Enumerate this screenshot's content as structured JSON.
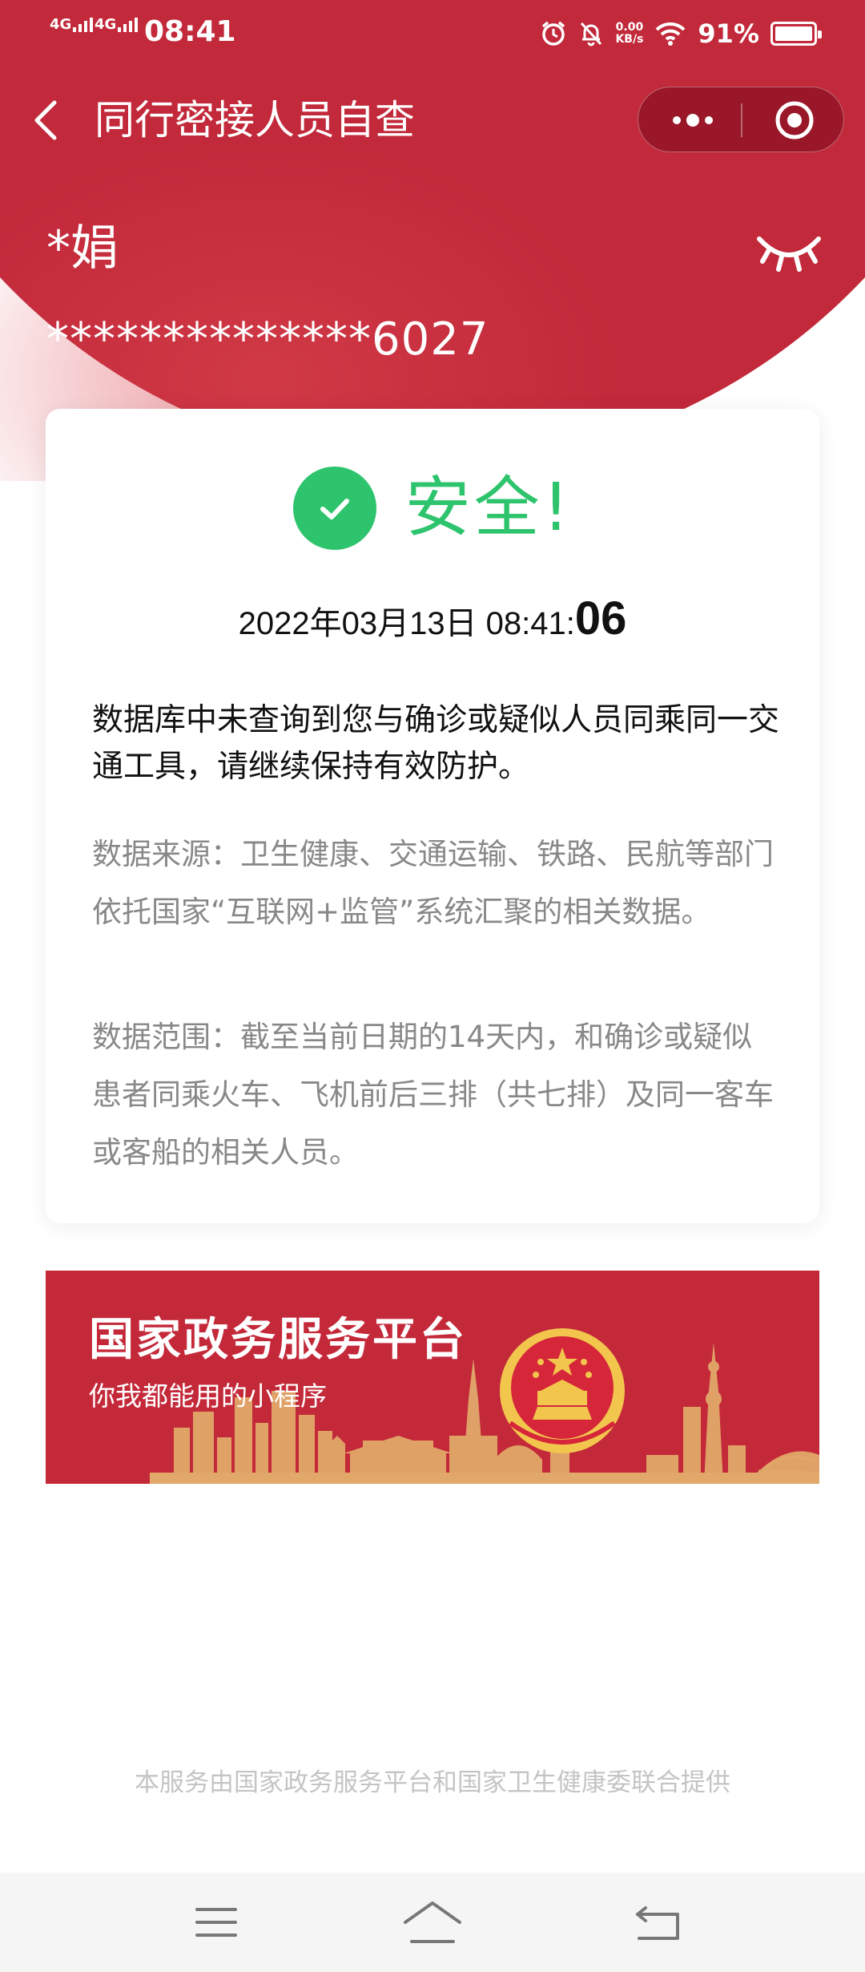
{
  "status_bar": {
    "signal1": "4G",
    "signal2": "4G",
    "time": "08:41",
    "net_speed_value": "0.00",
    "net_speed_unit": "KB/s",
    "battery": "91%"
  },
  "nav": {
    "title": "同行密接人员自查"
  },
  "user": {
    "name": "*娟",
    "id_masked": "**************6027"
  },
  "result": {
    "status": "安全!",
    "time_main": "2022年03月13日 08:41:",
    "time_seconds": "06",
    "message": "数据库中未查询到您与确诊或疑似人员同乘同一交通工具，请继续保持有效防护。",
    "source": "数据来源：卫生健康、交通运输、铁路、民航等部门依托国家“互联网+监管”系统汇聚的相关数据。",
    "scope": "数据范围：截至当前日期的14天内，和确诊或疑似患者同乘火车、飞机前后三排（共七排）及同一客车或客船的相关人员。"
  },
  "banner": {
    "title": "国家政务服务平台",
    "subtitle": "你我都能用的小程序"
  },
  "footer": {
    "provider": "本服务由国家政务服务平台和国家卫生健康委联合提供"
  },
  "colors": {
    "header_red": "#c2293a",
    "safe_green": "#2dc46d",
    "banner_red": "#c4293a",
    "skyline_gold": "#e2a86a"
  },
  "icons": {
    "back": "chevron-left-icon",
    "more": "more-dots-icon",
    "close": "target-circle-icon",
    "eye": "eye-closed-icon",
    "check": "check-icon",
    "emblem": "national-emblem-icon",
    "menu": "menu-icon",
    "home": "home-icon",
    "return": "return-icon"
  }
}
